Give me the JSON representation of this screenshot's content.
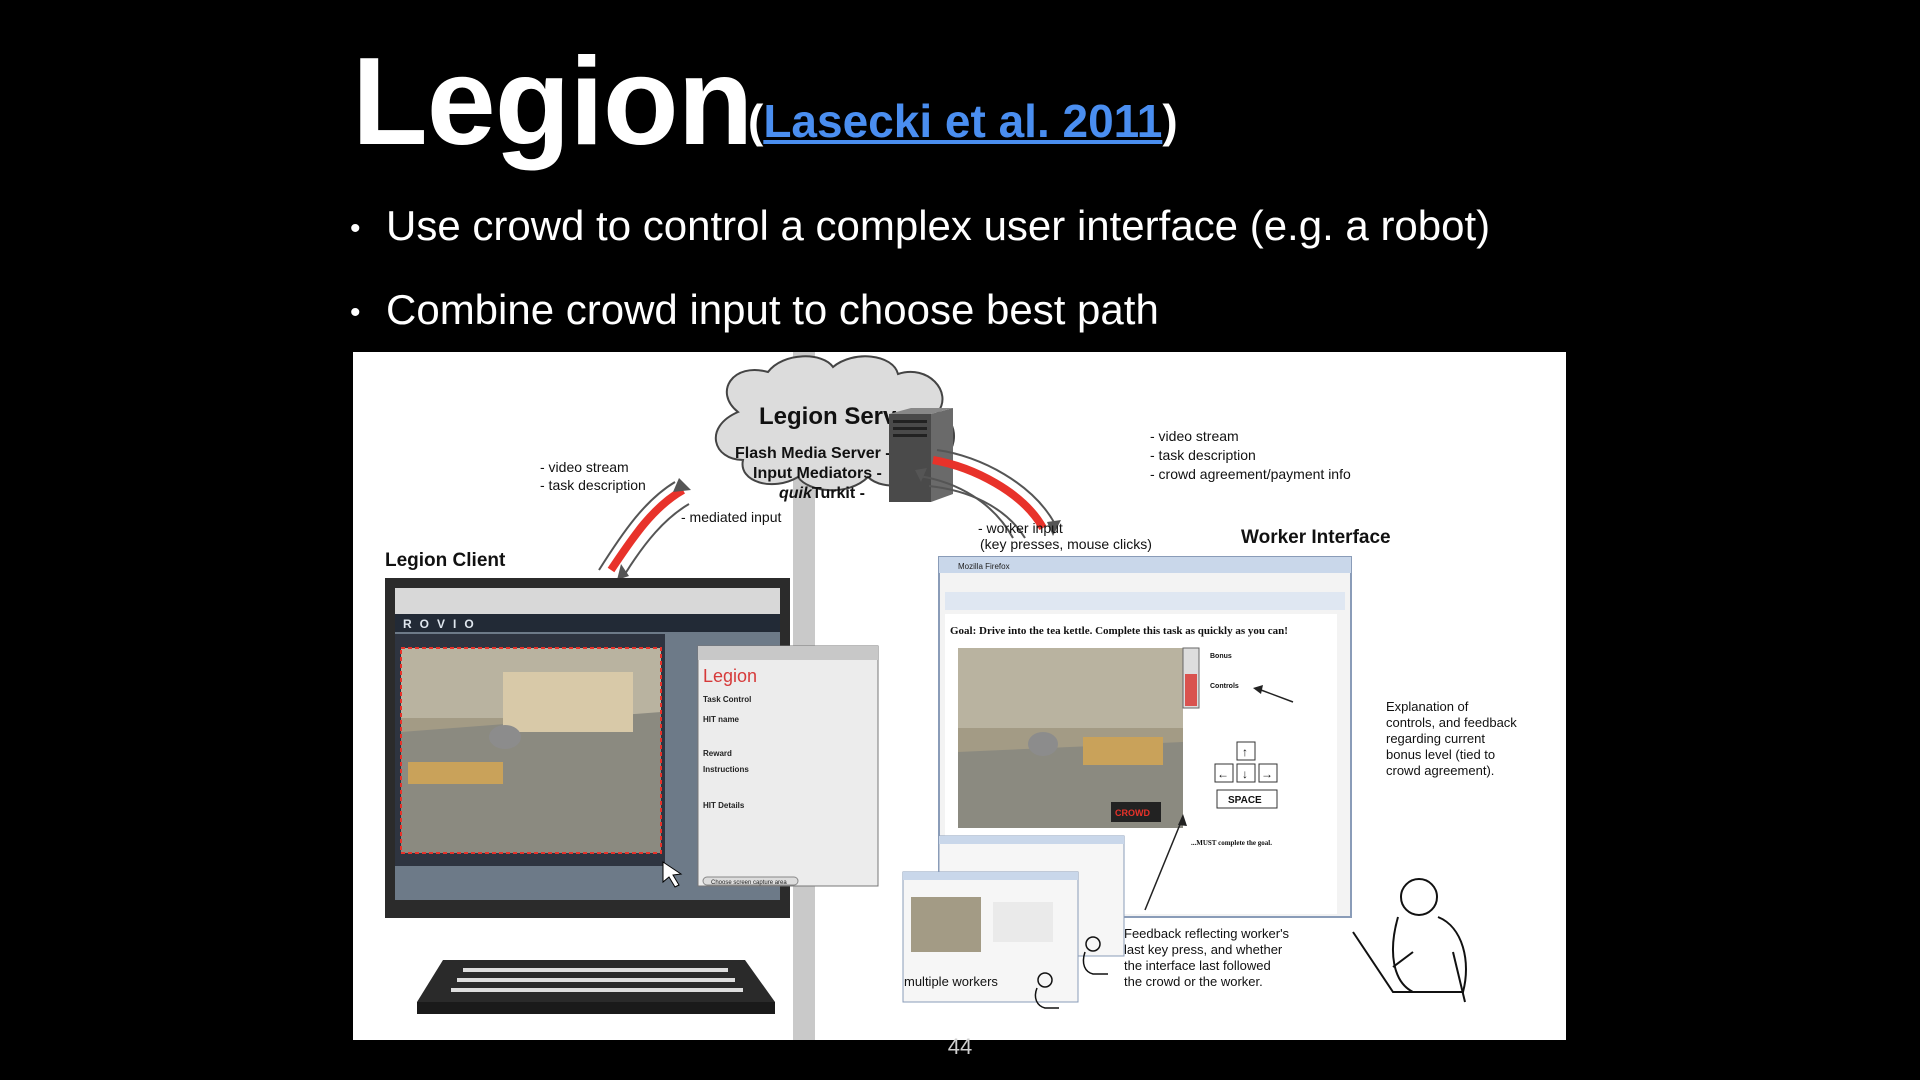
{
  "slide": {
    "title": "Legion",
    "citation_open": "(",
    "citation_link": "Lasecki et al. 2011",
    "citation_close": ")",
    "bullets": [
      "Use crowd to control a complex user interface (e.g. a robot)",
      "Combine crowd input to choose best path"
    ],
    "page_number": "44"
  },
  "figure": {
    "server": {
      "title": "Legion Server",
      "line1": "Flash Media Server -",
      "line2": "Input Mediators -",
      "line3_italic": "quik",
      "line3_rest": "Turkit -"
    },
    "left_labels": {
      "line1": "- video stream",
      "line2": "- task description",
      "mediated": "- mediated input",
      "client": "Legion Client"
    },
    "right_labels": {
      "line1": "- video stream",
      "line2": "- task description",
      "line3": "- crowd agreement/payment info",
      "worker_input1": "- worker input",
      "worker_input2": "(key presses, mouse clicks)",
      "worker_interface": "Worker Interface"
    },
    "client_screen": {
      "brand": "ROVIO",
      "panel_title": "Legion",
      "task_control": "Task Control",
      "hit_name": "HIT name",
      "reward": "Reward",
      "instructions": "Instructions",
      "hit_details": "HIT Details",
      "capture_btn": "Choose screen capture area"
    },
    "worker_window": {
      "browser": "Mozilla Firefox",
      "goal": "Goal: Drive into the tea kettle. Complete this task as quickly as you can!",
      "bonus": "Bonus",
      "controls": "Controls",
      "space": "SPACE",
      "crowd_badge": "CROWD",
      "must_text": "...MUST complete the goal."
    },
    "annotations": {
      "explanation": [
        "Explanation of",
        "controls, and feedback",
        "regarding current",
        "bonus level (tied to",
        "crowd agreement)."
      ],
      "feedback": [
        "Feedback reflecting worker's",
        "last key press, and whether",
        "the interface last followed",
        "the crowd or the worker."
      ],
      "multiple_workers": "multiple workers"
    },
    "colors": {
      "arrow_red": "#e8322a",
      "link_blue": "#4a8ef0"
    }
  }
}
